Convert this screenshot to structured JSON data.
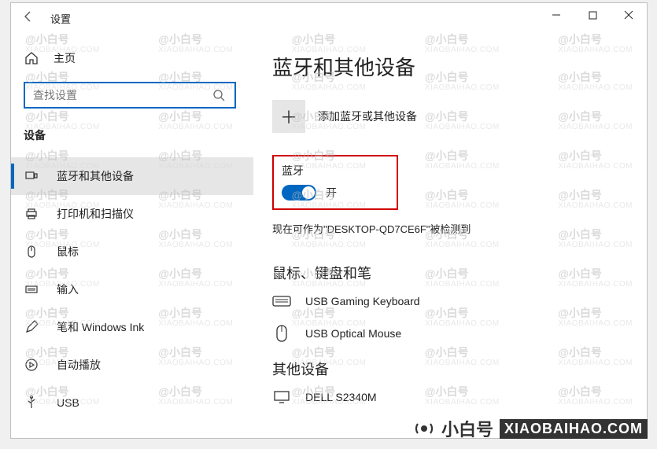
{
  "titlebar": {
    "app_name": "设置"
  },
  "sidebar": {
    "home_label": "主页",
    "search_placeholder": "查找设置",
    "section_label": "设备",
    "items": [
      {
        "label": "蓝牙和其他设备"
      },
      {
        "label": "打印机和扫描仪"
      },
      {
        "label": "鼠标"
      },
      {
        "label": "输入"
      },
      {
        "label": "笔和 Windows Ink"
      },
      {
        "label": "自动播放"
      },
      {
        "label": "USB"
      }
    ]
  },
  "main": {
    "page_title": "蓝牙和其他设备",
    "add_device_label": "添加蓝牙或其他设备",
    "bluetooth_label": "蓝牙",
    "toggle_label": "开",
    "discoverable_text": "现在可作为\"DESKTOP-QD7CE6F\"被检测到",
    "section_mouse_kb": "鼠标、键盘和笔",
    "devices_mk": [
      {
        "label": "USB Gaming Keyboard"
      },
      {
        "label": "USB Optical Mouse"
      }
    ],
    "section_other": "其他设备",
    "devices_other": [
      {
        "label": "DELL S2340M"
      }
    ]
  },
  "branding": {
    "logo_cn": "小白号",
    "logo_en": "XIAOBAIHAO.COM",
    "wm_handle": "@小白号",
    "wm_domain": "XIAOBAIHAO.COM"
  }
}
